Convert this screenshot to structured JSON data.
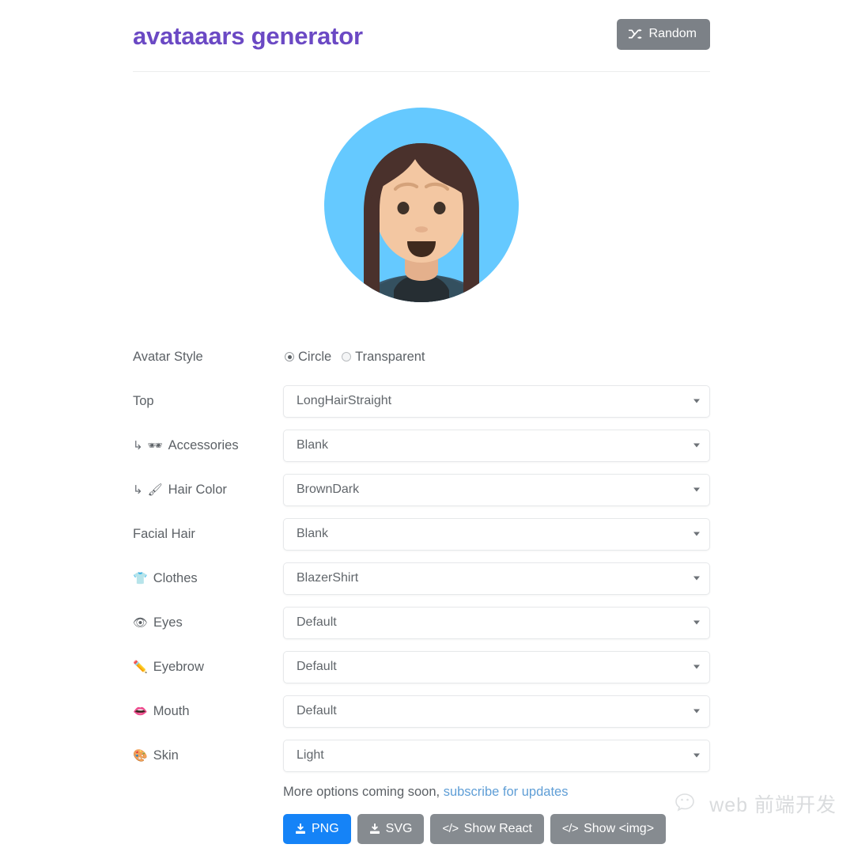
{
  "header": {
    "title": "avataaars generator",
    "random_button": {
      "label": "Random",
      "icon": "shuffle-icon"
    }
  },
  "avatar": {
    "style": "Circle",
    "colors": {
      "background": "#65c9ff",
      "hair": "#4a312c",
      "skin": "#f3c7a2",
      "skin_shadow": "#e4b08c",
      "eyes": "#3f3229",
      "eyebrow": "#d4a27a",
      "mouth_inner": "#3f2a1e",
      "blazer": "#3c5a6e",
      "blazer_dark": "#34505f",
      "shirt": "#262e33",
      "pocket_square": "#d3e0e8"
    }
  },
  "form": {
    "avatar_style": {
      "label": "Avatar Style",
      "options": [
        {
          "label": "Circle",
          "selected": true
        },
        {
          "label": "Transparent",
          "selected": false
        }
      ]
    },
    "rows": [
      {
        "label": "Top",
        "emoji": "",
        "sub": false,
        "value": "LongHairStraight"
      },
      {
        "label": "Accessories",
        "emoji": "🕶",
        "sub": true,
        "value": "Blank"
      },
      {
        "label": "Hair Color",
        "emoji": "🖌",
        "sub": true,
        "value": "BrownDark"
      },
      {
        "label": "Facial Hair",
        "emoji": "",
        "sub": false,
        "value": "Blank"
      },
      {
        "label": "Clothes",
        "emoji": "👕",
        "sub": false,
        "value": "BlazerShirt"
      },
      {
        "label": "Eyes",
        "emoji": "👁",
        "sub": false,
        "value": "Default"
      },
      {
        "label": "Eyebrow",
        "emoji": "✏️",
        "sub": false,
        "value": "Default"
      },
      {
        "label": "Mouth",
        "emoji": "👄",
        "sub": false,
        "value": "Default"
      },
      {
        "label": "Skin",
        "emoji": "🎨",
        "sub": false,
        "value": "Light"
      }
    ],
    "sub_arrow": "↳"
  },
  "footer": {
    "more_options_text": "More options coming soon,",
    "subscribe_link": "subscribe for updates",
    "buttons": [
      {
        "label": "PNG",
        "icon": "download-icon",
        "style": "primary"
      },
      {
        "label": "SVG",
        "icon": "download-icon",
        "style": "secondary"
      },
      {
        "label": "Show React",
        "icon": "code-icon",
        "style": "secondary"
      },
      {
        "label": "Show <img>",
        "icon": "code-icon",
        "style": "secondary"
      }
    ],
    "code_icon_glyph": "</>"
  },
  "watermark": {
    "text": "web 前端开发"
  },
  "colors": {
    "title_purple": "#6b49c4",
    "primary_blue": "#1583f7",
    "gray_button": "#868b90",
    "link_blue": "#5f9ed6"
  }
}
